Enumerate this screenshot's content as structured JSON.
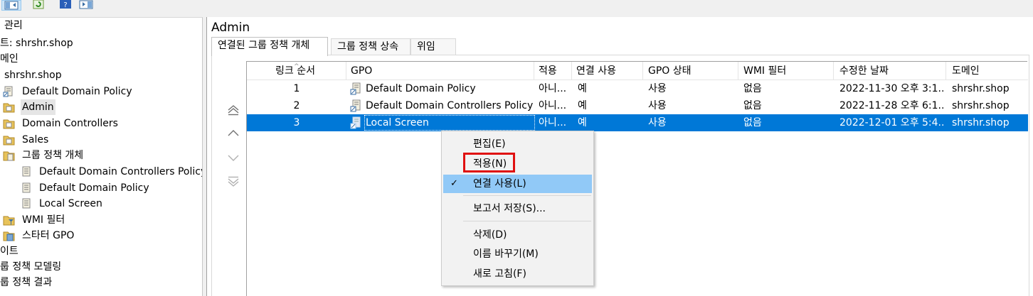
{
  "tree": {
    "items": [
      {
        "label": "관리",
        "icon": "none"
      },
      {
        "label": "트: shrshr.shop",
        "icon": "none"
      },
      {
        "label": "메인",
        "icon": "none"
      },
      {
        "label": "shrshr.shop",
        "icon": "none"
      },
      {
        "label": "Default Domain Policy",
        "icon": "gpo-link-icon"
      },
      {
        "label": "Admin",
        "icon": "folder-ou-icon"
      },
      {
        "label": "Domain Controllers",
        "icon": "folder-ou-icon"
      },
      {
        "label": "Sales",
        "icon": "folder-ou-icon"
      },
      {
        "label": "그룹 정책 개체",
        "icon": "folder-gpo-icon"
      },
      {
        "label": "Default Domain Controllers Policy",
        "icon": "gpo-scroll-icon"
      },
      {
        "label": "Default Domain Policy",
        "icon": "gpo-scroll-icon"
      },
      {
        "label": "Local Screen",
        "icon": "gpo-scroll-icon"
      },
      {
        "label": "WMI 필터",
        "icon": "wmi-filter-icon"
      },
      {
        "label": "스타터 GPO",
        "icon": "starter-gpo-icon"
      },
      {
        "label": "이트",
        "icon": "none"
      },
      {
        "label": "룹 정책 모델링",
        "icon": "none"
      },
      {
        "label": "룹 정책 결과",
        "icon": "none"
      }
    ]
  },
  "main": {
    "title": "Admin",
    "tabs": [
      {
        "label": "연결된 그룹 정책 개체"
      },
      {
        "label": "그룹 정책 상속"
      },
      {
        "label": "위임"
      }
    ],
    "columns": [
      "링크 순서",
      "GPO",
      "적용",
      "연결 사용",
      "GPO 상태",
      "WMI 필터",
      "수정한 날짜",
      "도메인"
    ],
    "rows": [
      {
        "order": "1",
        "gpo": "Default Domain Policy",
        "enforced": "아니...",
        "link_enabled": "예",
        "status": "사용",
        "wmi": "없음",
        "modified": "2022-11-30 오후 3:1...",
        "domain": "shrshr.shop"
      },
      {
        "order": "2",
        "gpo": "Default Domain Controllers Policy",
        "enforced": "아니...",
        "link_enabled": "예",
        "status": "사용",
        "wmi": "없음",
        "modified": "2022-11-28 오후 6:1...",
        "domain": "shrshr.shop"
      },
      {
        "order": "3",
        "gpo": "Local Screen",
        "enforced": "아니...",
        "link_enabled": "예",
        "status": "사용",
        "wmi": "없음",
        "modified": "2022-12-01 오후 5:4...",
        "domain": "shrshr.shop"
      }
    ]
  },
  "context_menu": {
    "items": [
      {
        "label": "편집(E)"
      },
      {
        "label": "적용(N)"
      },
      {
        "label": "연결 사용(L)",
        "checked": true
      },
      {
        "label": "보고서 저장(S)..."
      },
      {
        "label": "삭제(D)"
      },
      {
        "label": "이름 바꾸기(M)"
      },
      {
        "label": "새로 고침(F)"
      }
    ],
    "check_glyph": "✓"
  },
  "colors": {
    "selection": "#0078d7",
    "menu_highlight": "#91c9f7",
    "annotation_red": "#e01010"
  }
}
